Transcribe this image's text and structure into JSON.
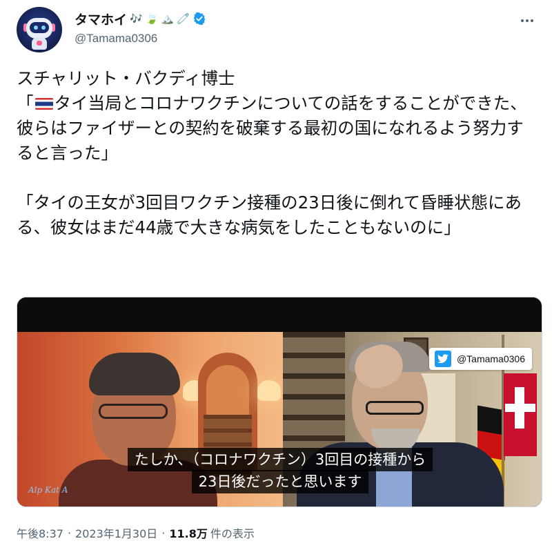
{
  "author": {
    "display_name": "タマホイ",
    "name_emojis": [
      "🎶",
      "🍃",
      "🏔️",
      "🧷"
    ],
    "handle": "@Tamama0306",
    "verified": true,
    "avatar_icon": "robot-avatar-icon"
  },
  "tweet": {
    "line1": "スチャリット・バクディ博士",
    "quote1_open": "「",
    "quote1_body": "タイ当局とコロナワクチンについての話をすることができた、彼らはファイザーとの契約を破棄する最初の国になれるよう努力すると言った」",
    "quote2": "「タイの王女が3回目ワクチン接種の23日後に倒れて昏睡状態にある、彼女はまだ44歳で大きな病気をしたこともないのに」",
    "flag_icon": "thailand-flag-icon"
  },
  "media": {
    "badge_handle": "@Tamama0306",
    "subtitle_line1": "たしか、（コロナワクチン）3回目の接種から",
    "subtitle_line2": "23日後だったと思います",
    "signature": "Alp Kat A"
  },
  "meta": {
    "time": "午後8:37",
    "date": "2023年1月30日",
    "views_count": "11.8万",
    "views_label": "件の表示"
  },
  "colors": {
    "text": "#0f1419",
    "secondary": "#536471",
    "verified_blue": "#1d9bf0"
  }
}
